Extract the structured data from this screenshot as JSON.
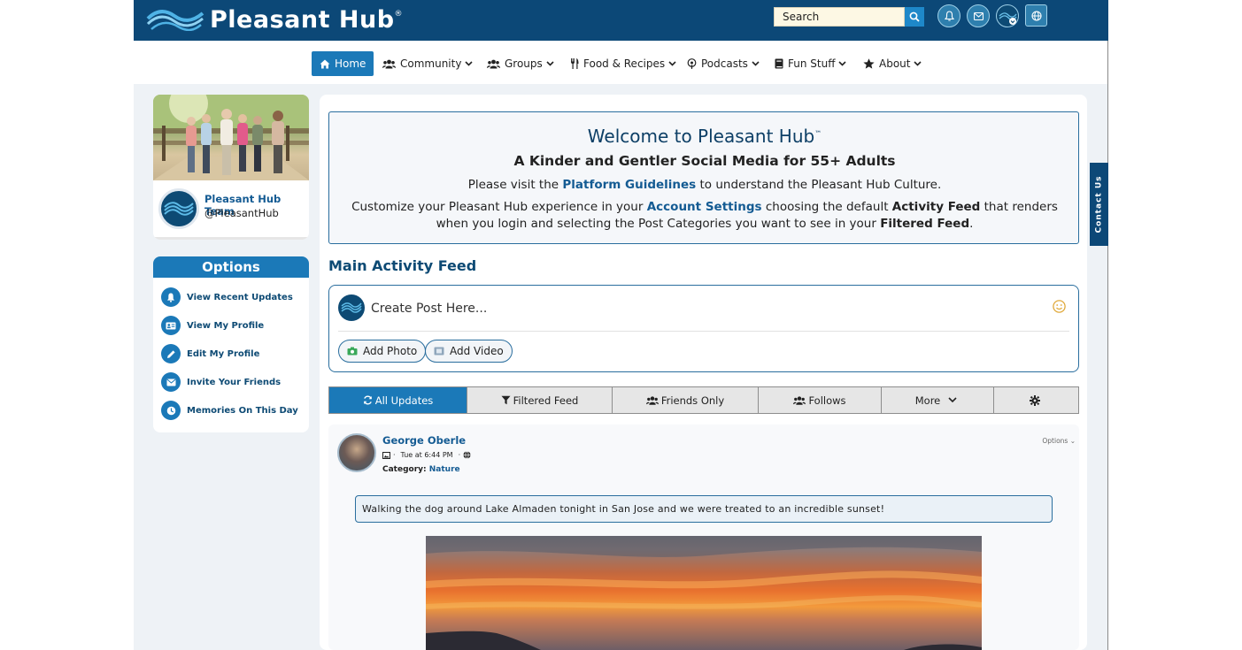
{
  "header": {
    "brand": "Pleasant Hub",
    "brand_tm": "®",
    "search_placeholder": "Search"
  },
  "nav": {
    "home": "Home",
    "community": "Community",
    "groups": "Groups",
    "food": "Food & Recipes",
    "podcasts": "Podcasts",
    "fun": "Fun Stuff",
    "about": "About"
  },
  "profile": {
    "name": "Pleasant Hub Team",
    "handle": "@PleasantHub"
  },
  "options": {
    "title": "Options",
    "items": [
      {
        "label": "View Recent Updates",
        "icon": "bell-icon"
      },
      {
        "label": "View My Profile",
        "icon": "id-card-icon"
      },
      {
        "label": "Edit My Profile",
        "icon": "pencil-icon"
      },
      {
        "label": "Invite Your Friends",
        "icon": "envelope-icon"
      },
      {
        "label": "Memories On This Day",
        "icon": "clock-icon"
      }
    ]
  },
  "welcome": {
    "title": "Welcome to Pleasant Hub",
    "tm": "™",
    "subtitle": "A Kinder and Gentler Social Media for 55+ Adults",
    "l1_a": "Please visit the ",
    "l1_link": "Platform Guidelines",
    "l1_b": " to understand the Pleasant Hub Culture.",
    "l2_a": "Customize your Pleasant Hub experience in your ",
    "l2_link": "Account Settings",
    "l2_b": " choosing the default ",
    "l2_bold1": "Activity Feed",
    "l2_c": " that renders when you login and selecting the Post Categories you want to see in your ",
    "l2_bold2": "Filtered Feed",
    "l2_d": "."
  },
  "feed": {
    "title": "Main Activity Feed",
    "create_post": "Create Post Here...",
    "add_photo": "Add Photo",
    "add_video": "Add Video"
  },
  "tabs": {
    "all": "All Updates",
    "filtered": "Filtered Feed",
    "friends": "Friends Only",
    "follows": "Follows",
    "more": "More"
  },
  "post": {
    "author": "George Oberle",
    "time": "Tue at 6:44 PM",
    "category_label": "Category:",
    "category": "Nature",
    "options": "Options",
    "text": "Walking the dog around Lake Almaden tonight in San Jose and we were treated to an incredible sunset!"
  },
  "contact": "Contact Us",
  "colors": {
    "brand_dark": "#0c4877",
    "accent": "#1b79b8"
  }
}
